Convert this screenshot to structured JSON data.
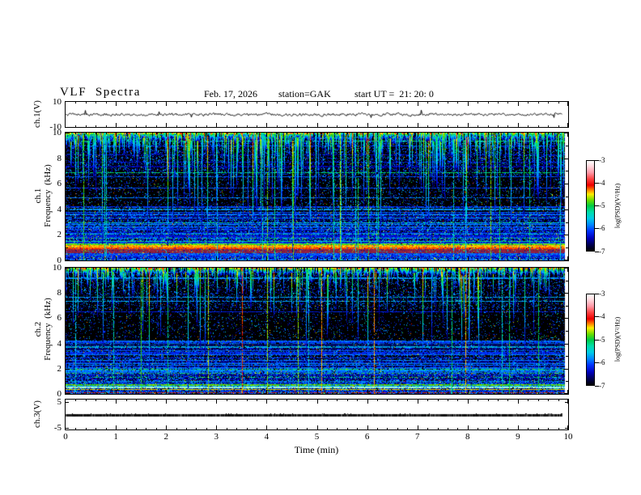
{
  "header": {
    "title": "VLF  Spectra",
    "date": "Feb. 17, 2026",
    "station": "station=GAK",
    "start_ut": "start UT =  21: 20: 0"
  },
  "labels": {
    "ch1_wave": "ch.1(V)",
    "ch1_spec": "ch.1\nFrequency  (kHz)",
    "ch2_spec": "ch.2\nFrequency  (kHz)",
    "ch3_wave": "ch.3(V)",
    "xlabel": "Time  (min)"
  },
  "axes": {
    "x_ticks": [
      0,
      1,
      2,
      3,
      4,
      5,
      6,
      7,
      8,
      9,
      10
    ],
    "x_minor_step_min": 0.2,
    "xlabel": "Time  (min)",
    "wave_y_ticks": [
      10,
      -10
    ],
    "spec_y_ticks": [
      10,
      8,
      6,
      4,
      2,
      0
    ],
    "spec_y_minor_ticks": [
      9,
      7,
      5,
      3,
      1
    ],
    "ch3_y_ticks": [
      5,
      -5
    ]
  },
  "colorbar": {
    "ticks": [
      "-3",
      "-4",
      "-5",
      "-6",
      "-7"
    ],
    "label": "log(PSD)(V²/Hz)"
  },
  "chart_data": [
    {
      "panel": "ch.1 voltage trace",
      "type": "line",
      "ylabel": "ch.1(V)",
      "ylim": [
        -10,
        10
      ],
      "x_range_min": [
        0,
        10
      ],
      "mean_V": 0,
      "noise_amplitude_V": 1,
      "description": "continuous noisy trace centered near 0 V with ~±1 V fluctuations and occasional ±3 V spikes, ends near 9.8 min"
    },
    {
      "panel": "ch.1 spectrogram",
      "type": "heatmap",
      "ylabel": "ch.1 Frequency (kHz)",
      "ylim_kHz": [
        0,
        10
      ],
      "x_range_min": [
        0,
        10
      ],
      "z_scale": "log(PSD)(V²/Hz)",
      "zlim": [
        -7,
        -3
      ],
      "features": [
        "dense vertical sferic streaks (blue/cyan/green) descending from 10 kHz, most ending near 6.5-7 kHz, some reaching below 2 kHz",
        "mostly black background between 3.5 and 6.5 kHz",
        "diffuse blue noise with horizontal banding below 3 kHz",
        "weak narrowband lines near 2.0, 1.75 and 1.45 kHz",
        "strong yellow/orange band at about 0.9-1.3 kHz",
        "dark red/maroon band at about 0.6-0.9 kHz",
        "about 20 full-height cyan/green vertical lines"
      ]
    },
    {
      "panel": "ch.2 spectrogram",
      "type": "heatmap",
      "ylabel": "ch.2 Frequency (kHz)",
      "ylim_kHz": [
        0,
        10
      ],
      "x_range_min": [
        0,
        10
      ],
      "z_scale": "log(PSD)(V²/Hz)",
      "zlim": [
        -7,
        -3
      ],
      "features": [
        "sparser blue-dominated sferic streaks from 10 kHz down to ~6.5 kHz",
        "dark background with thin horizontal blue rows in mid frequencies",
        "narrowband green lines near 2.0, 1.65 and 0.7 kHz",
        "bright cyan line near 0.5 kHz, yellow line near 0.35 kHz, red line near 0.1 kHz",
        "about 16 full-height vertical lines, a few orange/red"
      ]
    },
    {
      "panel": "ch.3 voltage trace",
      "type": "line",
      "ylabel": "ch.3(V)",
      "ylim": [
        -5,
        5
      ],
      "value_V": 0,
      "description": "flat dark trace at 0 V from 0 to ~9.8 min"
    }
  ],
  "render": {
    "colormap_stops": [
      [
        0.0,
        "#000000"
      ],
      [
        0.07,
        "#000055"
      ],
      [
        0.14,
        "#0000bb"
      ],
      [
        0.22,
        "#0033ff"
      ],
      [
        0.29,
        "#0088ff"
      ],
      [
        0.36,
        "#00cce6"
      ],
      [
        0.43,
        "#00ddaa"
      ],
      [
        0.5,
        "#00cc44"
      ],
      [
        0.56,
        "#66dd00"
      ],
      [
        0.63,
        "#ffee00"
      ],
      [
        0.68,
        "#ff7700"
      ],
      [
        0.73,
        "#ee0000"
      ],
      [
        0.8,
        "#ff4444"
      ],
      [
        0.87,
        "#ff9aa8"
      ],
      [
        0.94,
        "#ffd8dd"
      ],
      [
        1.0,
        "#ffffff"
      ]
    ],
    "spec1": {
      "seed": 11,
      "dataWidth": 617,
      "baseDensity": 1.0,
      "rows": 75,
      "streakP": 0.82,
      "deepP": 0.22,
      "streakDepth1": 55,
      "streakDepth2": 120,
      "vlines": 22,
      "warmP": 0.06,
      "speckles": 2600,
      "bands": [
        {
          "f1": 2.1,
          "f2": 2.02,
          "p": 0.55,
          "v": 0.4
        },
        {
          "f1": 1.8,
          "f2": 1.73,
          "p": 0.5,
          "v": 0.46
        },
        {
          "f1": 1.5,
          "f2": 1.43,
          "p": 0.45,
          "v": 0.42
        },
        {
          "f1": 1.32,
          "f2": 1.22,
          "p": 0.9,
          "v": 0.55,
          "jit": 0.1
        },
        {
          "f1": 1.22,
          "f2": 1.02,
          "p": 0.97,
          "v": 0.66,
          "jit": 0.08
        },
        {
          "f1": 1.02,
          "f2": 0.88,
          "p": 0.95,
          "v": 0.7,
          "jit": 0.06
        },
        {
          "f1": 0.88,
          "f2": 0.6,
          "p": 0.92,
          "color": "#8c2040",
          "jit": 0.3
        },
        {
          "f1": 0.55,
          "f2": 0.42,
          "p": 0.75,
          "v": 0.25,
          "jit": 0.12
        },
        {
          "f1": 0.4,
          "f2": 0.3,
          "p": 0.6,
          "v": 0.18,
          "jit": 0.1
        }
      ]
    },
    "spec2": {
      "seed": 77,
      "dataWidth": 617,
      "baseDensity": 0.75,
      "rows": 60,
      "streakP": 0.58,
      "deepP": 0.16,
      "streakDepth1": 48,
      "streakDepth2": 110,
      "vlines": 16,
      "warmP": 0.15,
      "speckles": 1800,
      "bands": [
        {
          "f1": 2.0,
          "f2": 1.93,
          "p": 0.6,
          "v": 0.5
        },
        {
          "f1": 1.65,
          "f2": 1.58,
          "p": 0.55,
          "v": 0.52
        },
        {
          "f1": 1.35,
          "f2": 1.28,
          "p": 0.5,
          "v": 0.45
        },
        {
          "f1": 0.75,
          "f2": 0.65,
          "p": 0.85,
          "v": 0.55,
          "jit": 0.1
        },
        {
          "f1": 0.55,
          "f2": 0.45,
          "p": 0.9,
          "color": "#9fffe0",
          "jit": 0.2
        },
        {
          "f1": 0.4,
          "f2": 0.3,
          "p": 0.9,
          "v": 0.63,
          "jit": 0.06
        },
        {
          "f1": 0.16,
          "f2": 0.06,
          "p": 0.85,
          "color": "#cc2222",
          "jit": 0.25
        }
      ]
    },
    "wave": {
      "seed": 5,
      "dataWidth": 613
    },
    "ch3": {
      "seed": 9,
      "dataWidth": 613
    }
  }
}
